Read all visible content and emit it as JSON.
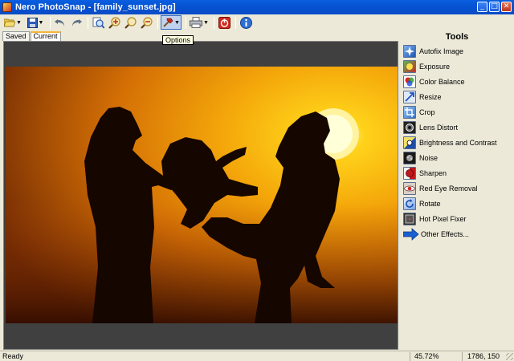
{
  "window": {
    "title": "Nero PhotoSnap - [family_sunset.jpg]",
    "controls": [
      "minimize",
      "maximize",
      "close"
    ]
  },
  "toolbar": {
    "buttons": [
      {
        "name": "open",
        "icon": "folder-open-icon",
        "has_dropdown": true
      },
      {
        "name": "save",
        "icon": "floppy-disk-icon",
        "has_dropdown": true
      },
      {
        "name": "undo",
        "icon": "undo-icon"
      },
      {
        "name": "redo",
        "icon": "redo-icon"
      },
      {
        "name": "zoom-fit",
        "icon": "zoom-fit-icon"
      },
      {
        "name": "zoom-in",
        "icon": "zoom-in-icon"
      },
      {
        "name": "zoom-actual",
        "icon": "zoom-actual-icon"
      },
      {
        "name": "zoom-out",
        "icon": "zoom-out-icon"
      },
      {
        "name": "options",
        "icon": "hammer-icon",
        "has_dropdown": true,
        "pressed": true
      },
      {
        "name": "print",
        "icon": "printer-icon",
        "has_dropdown": true
      },
      {
        "name": "exit",
        "icon": "power-icon"
      },
      {
        "name": "about",
        "icon": "info-icon"
      }
    ],
    "tooltip": "Options"
  },
  "tabs": [
    {
      "label": "Saved",
      "active": false
    },
    {
      "label": "Current",
      "active": true
    }
  ],
  "image": {
    "filename": "family_sunset.jpg",
    "description_icon": "sunset-silhouette-photo"
  },
  "tools": {
    "title": "Tools",
    "items": [
      {
        "label": "Autofix Image",
        "icon": "autofix-icon",
        "color": "#2f6fc9"
      },
      {
        "label": "Exposure",
        "icon": "exposure-icon",
        "color": "#3d7a3a"
      },
      {
        "label": "Color Balance",
        "icon": "color-balance-icon",
        "color": "#cc3333"
      },
      {
        "label": "Resize",
        "icon": "resize-icon",
        "color": "#2a63c4"
      },
      {
        "label": "Crop",
        "icon": "crop-icon",
        "color": "#2f78c9"
      },
      {
        "label": "Lens Distort",
        "icon": "lens-distort-icon",
        "color": "#303030"
      },
      {
        "label": "Brightness and Contrast",
        "icon": "brightness-contrast-icon",
        "color": "#1e5ec2"
      },
      {
        "label": "Noise",
        "icon": "noise-icon",
        "color": "#202020"
      },
      {
        "label": "Sharpen",
        "icon": "sharpen-icon",
        "color": "#c0181b"
      },
      {
        "label": "Red Eye Removal",
        "icon": "red-eye-icon",
        "color": "#b04040"
      },
      {
        "label": "Rotate",
        "icon": "rotate-icon",
        "color": "#2a6dd0"
      },
      {
        "label": "Hot Pixel Fixer",
        "icon": "hot-pixel-icon",
        "color": "#404040"
      }
    ],
    "other_effects": {
      "label": "Other Effects...",
      "icon": "arrow-right-icon",
      "color": "#1a5fd0"
    }
  },
  "status": {
    "text": "Ready",
    "zoom": "45.72%",
    "coords": "1786, 150"
  }
}
